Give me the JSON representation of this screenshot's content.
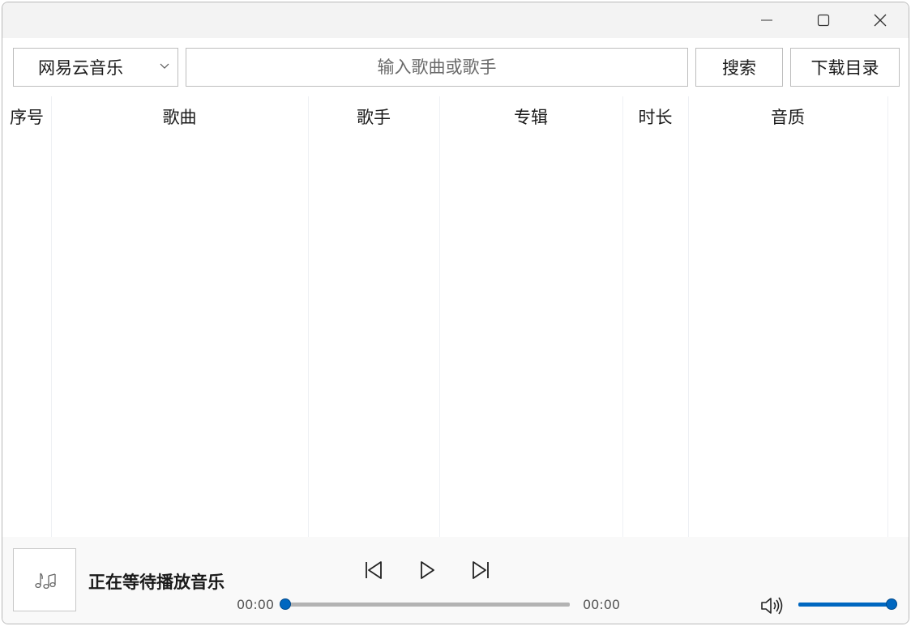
{
  "toolbar": {
    "source_selected": "网易云音乐",
    "search_placeholder": "输入歌曲或歌手",
    "search_value": "",
    "search_label": "搜索",
    "download_dir_label": "下载目录"
  },
  "table": {
    "columns": [
      "序号",
      "歌曲",
      "歌手",
      "专辑",
      "时长",
      "音质"
    ],
    "rows": []
  },
  "player": {
    "cover_icon": "music-note-icon",
    "status_text": "正在等待播放音乐",
    "current_time": "00:00",
    "total_time": "00:00",
    "progress": 0,
    "volume": 1.0,
    "accent_color": "#0067c0"
  },
  "window_controls": [
    "minimize-icon",
    "maximize-icon",
    "close-icon"
  ]
}
